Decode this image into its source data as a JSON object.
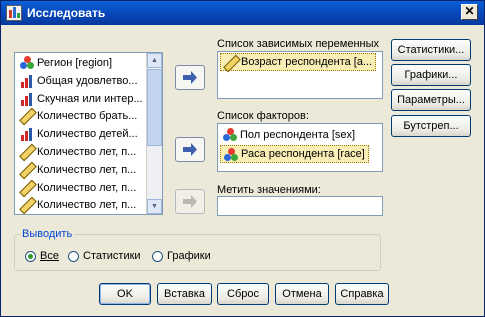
{
  "window": {
    "title": "Исследовать",
    "close_symbol": "✕"
  },
  "source_list": {
    "items": [
      {
        "label": "Регион [region]",
        "icon": "nominal-variable-icon"
      },
      {
        "label": "Общая удовлетво...",
        "icon": "ordinal-variable-icon"
      },
      {
        "label": "Скучная или интер...",
        "icon": "ordinal-variable-icon"
      },
      {
        "label": "Количество брать...",
        "icon": "scale-variable-icon"
      },
      {
        "label": "Количество детей...",
        "icon": "ordinal-variable-icon"
      },
      {
        "label": "Количество лет, п...",
        "icon": "scale-variable-icon"
      },
      {
        "label": "Количество лет, п...",
        "icon": "scale-variable-icon"
      },
      {
        "label": "Количество лет, п...",
        "icon": "scale-variable-icon"
      },
      {
        "label": "Количество лет, п...",
        "icon": "scale-variable-icon"
      }
    ]
  },
  "dependent": {
    "label": "Список зависимых переменных",
    "items": [
      {
        "label": "Возраст респондента [а...",
        "icon": "scale-variable-icon",
        "selected": true
      }
    ]
  },
  "factors": {
    "label": "Список факторов:",
    "items": [
      {
        "label": "Пол респондента [sex]",
        "icon": "nominal-variable-icon",
        "selected": false
      },
      {
        "label": "Раса респондента [race]",
        "icon": "nominal-variable-icon",
        "selected": true
      }
    ]
  },
  "label_cases": {
    "label": "Метить значениями:",
    "value": ""
  },
  "side_buttons": {
    "statistics": "Статистики...",
    "plots": "Графики...",
    "options": "Параметры...",
    "bootstrap": "Бутстреп..."
  },
  "display_group": {
    "title": "Выводить",
    "options": [
      "Все",
      "Статистики",
      "Графики"
    ],
    "selected": "Все"
  },
  "footer_buttons": {
    "ok": "OK",
    "paste": "Вставка",
    "reset": "Сброс",
    "cancel": "Отмена",
    "help": "Справка"
  }
}
